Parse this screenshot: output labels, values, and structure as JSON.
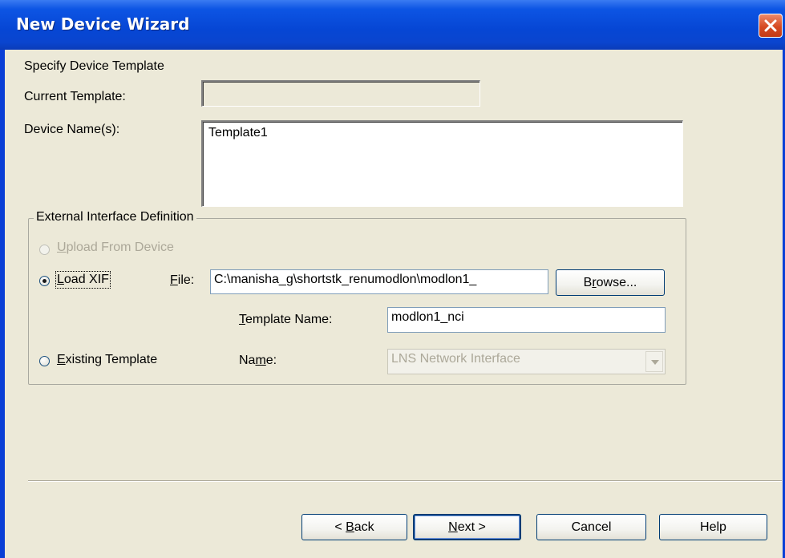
{
  "window": {
    "title": "New Device Wizard",
    "close_glyph": "×"
  },
  "section_heading": "Specify Device Template",
  "current_template": {
    "label": "Current Template:",
    "value": ""
  },
  "device_names": {
    "label": "Device Name(s):",
    "value": "Template1"
  },
  "external_interface": {
    "group_title": "External Interface Definition",
    "upload_option": {
      "label_mnemonic": "U",
      "label_rest": "pload From Device",
      "enabled": false,
      "selected": false
    },
    "load_xif_option": {
      "label_mnemonic": "L",
      "label_rest": "oad XIF",
      "selected": true
    },
    "file": {
      "label_mnemonic": "F",
      "label_rest": "ile:",
      "value": "C:\\manisha_g\\shortstk_renumodlon\\modlon1_"
    },
    "browse_button": {
      "label_pre": "B",
      "label_mnemonic": "r",
      "label_post": "owse..."
    },
    "template_name": {
      "label_mnemonic": "T",
      "label_rest": "emplate Name:",
      "value": "modlon1_nci"
    },
    "existing_template_option": {
      "label_mnemonic": "E",
      "label_rest": "xisting Template",
      "selected": false
    },
    "name": {
      "label_pre": "Na",
      "label_mnemonic": "m",
      "label_post": "e:",
      "selected_value": "LNS Network Interface",
      "enabled": false
    }
  },
  "buttons": {
    "back_pre": "< ",
    "back_mnemonic": "B",
    "back_post": "ack",
    "next_mnemonic": "N",
    "next_post": "ext >",
    "cancel": "Cancel",
    "help": "Help"
  },
  "colors": {
    "titlebar": "#0a46d3",
    "dialog_bg": "#ece9d8",
    "close_button": "#d64a22",
    "radio_dot": "#21a121",
    "disabled_text": "#aca899"
  },
  "icons": {
    "close": "close-icon",
    "combo": "chevron-down-icon"
  }
}
